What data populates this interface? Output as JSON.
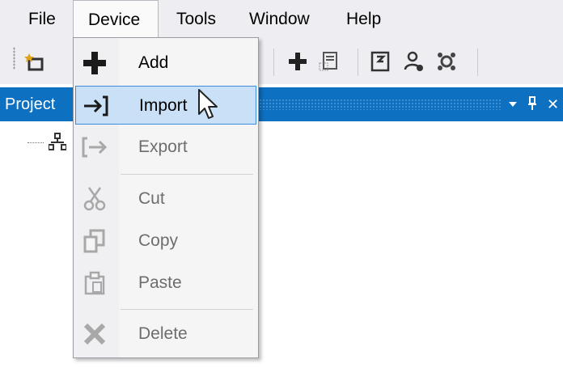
{
  "menubar": {
    "items": [
      {
        "label": "File"
      },
      {
        "label": "Device"
      },
      {
        "label": "Tools"
      },
      {
        "label": "Window"
      },
      {
        "label": "Help"
      }
    ]
  },
  "panel": {
    "title": "Project",
    "pin_glyph": "↓",
    "close_glyph": "✕"
  },
  "device_menu": {
    "items": [
      {
        "label": "Add",
        "icon": "plus-icon",
        "enabled": true
      },
      {
        "label": "Import",
        "icon": "import-icon",
        "enabled": true,
        "highlighted": true
      },
      {
        "label": "Export",
        "icon": "export-icon",
        "enabled": false
      },
      {
        "label": "Cut",
        "icon": "scissors-icon",
        "enabled": false
      },
      {
        "label": "Copy",
        "icon": "copy-icon",
        "enabled": false
      },
      {
        "label": "Paste",
        "icon": "paste-icon",
        "enabled": false
      },
      {
        "label": "Delete",
        "icon": "delete-icon",
        "enabled": false
      }
    ]
  },
  "colors": {
    "accent": "#0e70c0",
    "highlight": "#c9e0f7",
    "highlight_border": "#3c8edb",
    "menubar_bg": "#eeeef2"
  }
}
